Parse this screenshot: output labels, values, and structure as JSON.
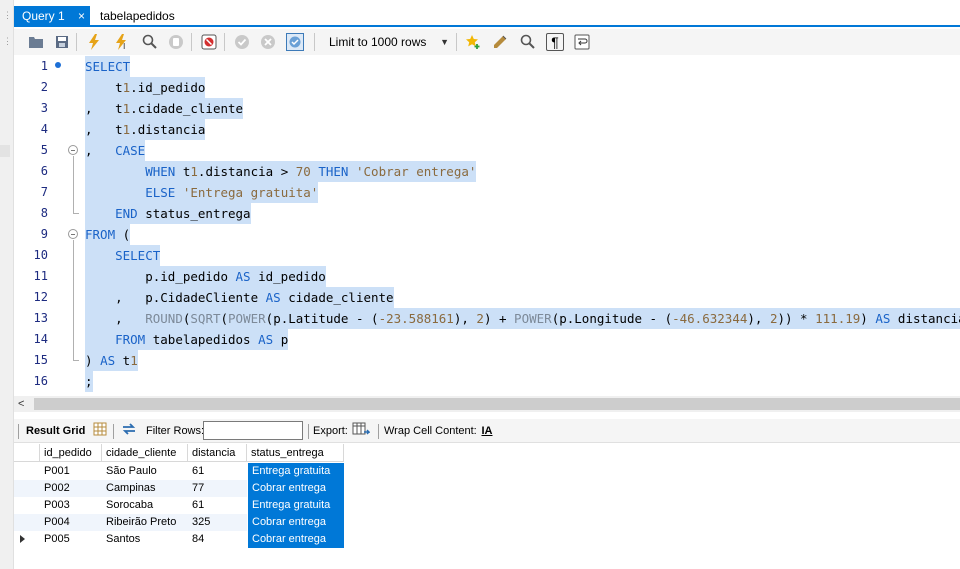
{
  "tabs": [
    {
      "label": "Query 1",
      "close": "×"
    },
    {
      "label": "tabelapedidos"
    }
  ],
  "toolbar": {
    "limit_label": "Limit to 1000 rows",
    "icons": [
      "open-folder-icon",
      "save-icon",
      "execute-icon",
      "execute-current-icon",
      "explain-icon",
      "stop-icon",
      "toggle-error-icon",
      "commit-icon",
      "rollback-icon",
      "autocommit-icon",
      "bookmark-icon",
      "beautify-icon",
      "find-icon",
      "invisible-chars-icon",
      "wrap-icon"
    ]
  },
  "editor": {
    "lines": [
      {
        "n": "1",
        "text": "SELECT"
      },
      {
        "n": "2",
        "text": "    t1.id_pedido"
      },
      {
        "n": "3",
        "text": ",   t1.cidade_cliente"
      },
      {
        "n": "4",
        "text": ",   t1.distancia"
      },
      {
        "n": "5",
        "text": ",   CASE"
      },
      {
        "n": "6",
        "text": "        WHEN t1.distancia > 70 THEN 'Cobrar entrega'"
      },
      {
        "n": "7",
        "text": "        ELSE 'Entrega gratuita'"
      },
      {
        "n": "8",
        "text": "    END status_entrega"
      },
      {
        "n": "9",
        "text": "FROM ("
      },
      {
        "n": "10",
        "text": "    SELECT"
      },
      {
        "n": "11",
        "text": "        p.id_pedido AS id_pedido"
      },
      {
        "n": "12",
        "text": "    ,   p.CidadeCliente AS cidade_cliente"
      },
      {
        "n": "13",
        "text": "    ,   ROUND(SQRT(POWER(p.Latitude - (-23.588161), 2) + POWER(p.Longitude - (-46.632344), 2)) * 111.19) AS distancia"
      },
      {
        "n": "14",
        "text": "    FROM tabelapedidos AS p"
      },
      {
        "n": "15",
        "text": ") AS t1"
      },
      {
        "n": "16",
        "text": ";"
      }
    ]
  },
  "result_toolbar": {
    "result_grid": "Result Grid",
    "filter_rows": "Filter Rows:",
    "filter_value": "",
    "export": "Export:",
    "wrap_cell": "Wrap Cell Content:"
  },
  "grid": {
    "columns": [
      "id_pedido",
      "cidade_cliente",
      "distancia",
      "status_entrega"
    ],
    "rows": [
      [
        "P001",
        "São Paulo",
        "61",
        "Entrega gratuita"
      ],
      [
        "P002",
        "Campinas",
        "77",
        "Cobrar entrega"
      ],
      [
        "P003",
        "Sorocaba",
        "61",
        "Entrega gratuita"
      ],
      [
        "P004",
        "Ribeirão Preto",
        "325",
        "Cobrar entrega"
      ],
      [
        "P005",
        "Santos",
        "84",
        "Cobrar entrega"
      ]
    ]
  },
  "colors": {
    "accent": "#0078d7",
    "selection": "#cce0f7",
    "keyword": "#1a63c8",
    "string": "#8a6a3e"
  }
}
